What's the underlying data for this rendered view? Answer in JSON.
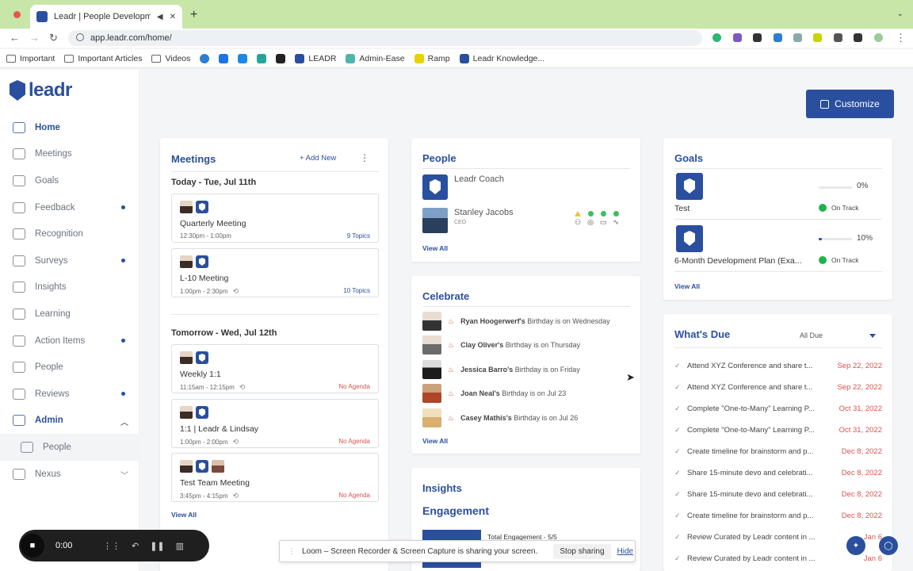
{
  "browser": {
    "tab_title": "Leadr | People Developmen",
    "url": "app.leadr.com/home/",
    "bookmarks": [
      "Important",
      "Important Articles",
      "Videos",
      "LEADR",
      "Admin-Ease",
      "Ramp",
      "Leadr Knowledge..."
    ]
  },
  "logo": {
    "text": "leadr"
  },
  "sidebar": {
    "items": [
      {
        "label": "Home",
        "icon": "home-icon"
      },
      {
        "label": "Meetings",
        "icon": "calendar-icon"
      },
      {
        "label": "Goals",
        "icon": "target-icon"
      },
      {
        "label": "Feedback",
        "icon": "feedback-icon"
      },
      {
        "label": "Recognition",
        "icon": "recognition-icon"
      },
      {
        "label": "Surveys",
        "icon": "survey-icon"
      },
      {
        "label": "Insights",
        "icon": "insights-icon"
      },
      {
        "label": "Learning",
        "icon": "learning-icon"
      },
      {
        "label": "Action Items",
        "icon": "checklist-icon"
      },
      {
        "label": "People",
        "icon": "people-icon"
      },
      {
        "label": "Reviews",
        "icon": "review-icon"
      },
      {
        "label": "Admin",
        "icon": "admin-icon"
      },
      {
        "label": "People",
        "icon": "people-icon"
      },
      {
        "label": "Nexus",
        "icon": "nexus-icon"
      }
    ]
  },
  "customize": {
    "label": "Customize"
  },
  "meetings": {
    "title": "Meetings",
    "add_new": "+ Add New",
    "today": "Today - Tue, Jul 11th",
    "tomorrow": "Tomorrow - Wed, Jul 12th",
    "items": [
      {
        "name": "Quarterly Meeting",
        "time": "12:30pm - 1:00pm",
        "tag": "9 Topics"
      },
      {
        "name": "L-10 Meeting",
        "time": "1:00pm - 2:30pm",
        "tag": "10 Topics"
      },
      {
        "name": "Weekly 1:1",
        "time": "11:15am - 12:15pm",
        "tag": "No Agenda"
      },
      {
        "name": "1:1 | Leadr & Lindsay",
        "time": "1:00pm - 2:00pm",
        "tag": "No Agenda"
      },
      {
        "name": "Test Team Meeting",
        "time": "3:45pm - 4:15pm",
        "tag": "No Agenda"
      }
    ],
    "view_all": "View All"
  },
  "people": {
    "title": "People",
    "coach": "Leadr Coach",
    "person_name": "Stanley Jacobs",
    "person_role": "CEO",
    "view_all": "View All"
  },
  "celebrate": {
    "title": "Celebrate",
    "items": [
      {
        "name": "Ryan Hoogerwerf's",
        "text": "Birthday is on Wednesday"
      },
      {
        "name": "Clay Oliver's",
        "text": "Birthday is on Thursday"
      },
      {
        "name": "Jessica Barro's",
        "text": "Birthday is on Friday"
      },
      {
        "name": "Joan Neal's",
        "text": "Birthday is on Jul 23"
      },
      {
        "name": "Casey Mathis's",
        "text": "Birthday is on Jul 26"
      }
    ],
    "view_all": "View All"
  },
  "insights": {
    "title": "Insights",
    "engagement": "Engagement",
    "total": "Total Engagement - 5/5"
  },
  "goals": {
    "title": "Goals",
    "items": [
      {
        "name": "Test",
        "progress": 0,
        "pct": "0%",
        "status": "On Track"
      },
      {
        "name": "6-Month Development Plan (Exa...",
        "progress": 10,
        "pct": "10%",
        "status": "On Track"
      }
    ],
    "view_all": "View All"
  },
  "due": {
    "title": "What's Due",
    "filter": "All Due",
    "items": [
      {
        "text": "Attend XYZ Conference and share t...",
        "date": "Sep 22, 2022"
      },
      {
        "text": "Attend XYZ Conference and share t...",
        "date": "Sep 22, 2022"
      },
      {
        "text": "Complete \"One-to-Many\" Learning P...",
        "date": "Oct 31, 2022"
      },
      {
        "text": "Complete \"One-to-Many\" Learning P...",
        "date": "Oct 31, 2022"
      },
      {
        "text": "Create timeline for brainstorm and p...",
        "date": "Dec 8, 2022"
      },
      {
        "text": "Share 15-minute devo and celebrati...",
        "date": "Dec 8, 2022"
      },
      {
        "text": "Share 15-minute devo and celebrati...",
        "date": "Dec 8, 2022"
      },
      {
        "text": "Create timeline for brainstorm and p...",
        "date": "Dec 8, 2022"
      },
      {
        "text": "Review Curated by Leadr content in ...",
        "date": "Jan 6"
      },
      {
        "text": "Review Curated by Leadr content in ...",
        "date": "Jan 6"
      }
    ]
  },
  "loom": {
    "time": "0:00",
    "banner": "Loom – Screen Recorder & Screen Capture is sharing your screen.",
    "stop": "Stop sharing",
    "hide": "Hide"
  },
  "colors": {
    "brand": "#2a4f9e",
    "alert": "#d9534f",
    "ok": "#22b14c"
  }
}
